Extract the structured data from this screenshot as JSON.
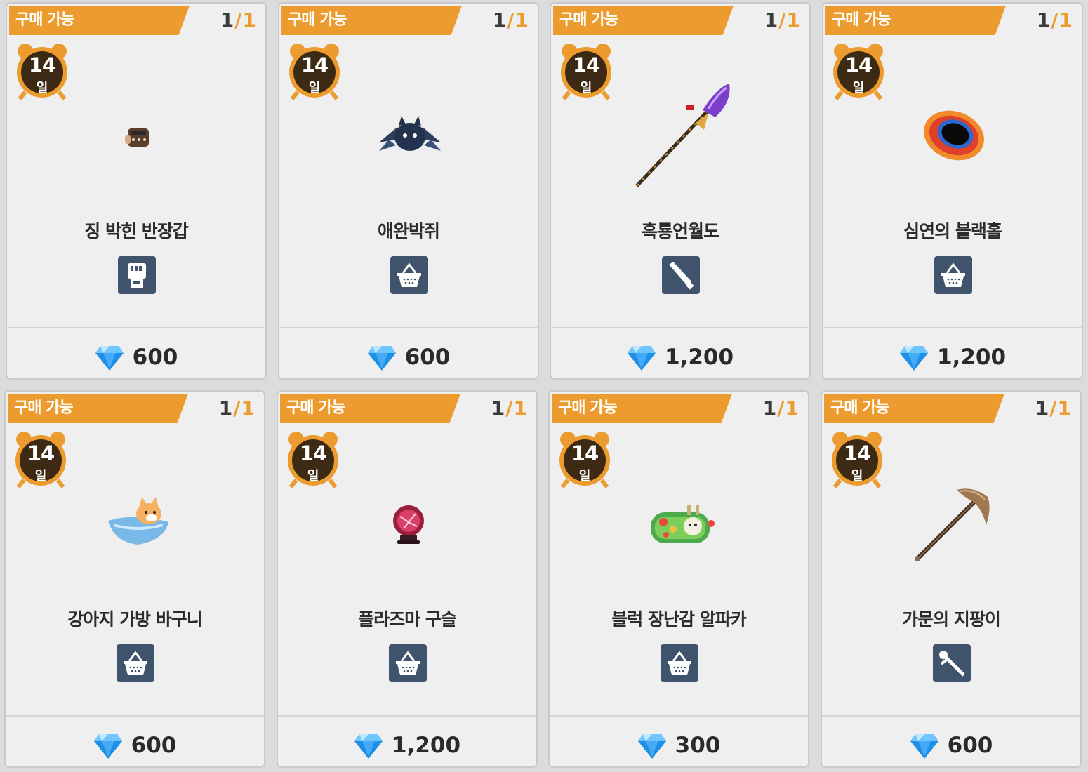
{
  "shop": {
    "items": [
      {
        "status": "구매 가능",
        "stock_current": "1",
        "stock_sep": "/",
        "stock_max": "1",
        "days": "14",
        "days_unit": "일",
        "name": "징 박힌 반장갑",
        "category_icon": "glove-fist-icon",
        "art_icon": "studded-glove-icon",
        "price": "600"
      },
      {
        "status": "구매 가능",
        "stock_current": "1",
        "stock_sep": "/",
        "stock_max": "1",
        "days": "14",
        "days_unit": "일",
        "name": "애완박쥐",
        "category_icon": "basket-icon",
        "art_icon": "pet-bat-icon",
        "price": "600"
      },
      {
        "status": "구매 가능",
        "stock_current": "1",
        "stock_sep": "/",
        "stock_max": "1",
        "days": "14",
        "days_unit": "일",
        "name": "흑룡언월도",
        "category_icon": "sword-icon",
        "art_icon": "glaive-icon",
        "price": "1,200"
      },
      {
        "status": "구매 가능",
        "stock_current": "1",
        "stock_sep": "/",
        "stock_max": "1",
        "days": "14",
        "days_unit": "일",
        "name": "심연의 블랙홀",
        "category_icon": "basket-icon",
        "art_icon": "black-hole-icon",
        "price": "1,200"
      },
      {
        "status": "구매 가능",
        "stock_current": "1",
        "stock_sep": "/",
        "stock_max": "1",
        "days": "14",
        "days_unit": "일",
        "name": "강아지 가방 바구니",
        "category_icon": "basket-icon",
        "art_icon": "dog-basket-icon",
        "price": "600"
      },
      {
        "status": "구매 가능",
        "stock_current": "1",
        "stock_sep": "/",
        "stock_max": "1",
        "days": "14",
        "days_unit": "일",
        "name": "플라즈마 구슬",
        "category_icon": "basket-icon",
        "art_icon": "plasma-orb-icon",
        "price": "1,200"
      },
      {
        "status": "구매 가능",
        "stock_current": "1",
        "stock_sep": "/",
        "stock_max": "1",
        "days": "14",
        "days_unit": "일",
        "name": "블럭 장난감 알파카",
        "category_icon": "basket-icon",
        "art_icon": "alpaca-toy-icon",
        "price": "300"
      },
      {
        "status": "구매 가능",
        "stock_current": "1",
        "stock_sep": "/",
        "stock_max": "1",
        "days": "14",
        "days_unit": "일",
        "name": "가문의 지팡이",
        "category_icon": "staff-tool-icon",
        "art_icon": "pickaxe-staff-icon",
        "price": "600"
      }
    ]
  },
  "colors": {
    "ribbon": "#ec9c2e",
    "clock_face": "#3d2a14",
    "category_bg": "#3f536d",
    "gem": "#1e8fe6"
  }
}
